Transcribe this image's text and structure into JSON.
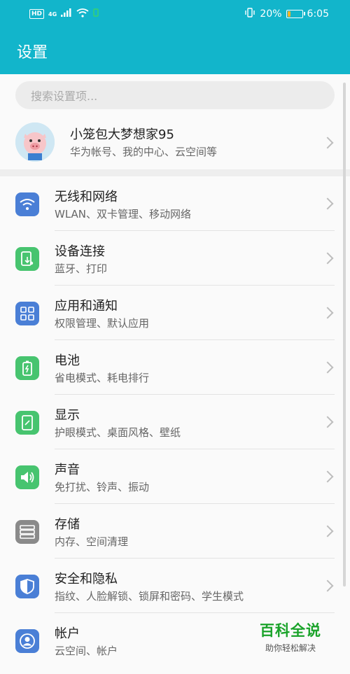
{
  "status_bar": {
    "hd": "HD",
    "network": "4G",
    "battery_percent": "20%",
    "battery_level": 0.2,
    "time": "6:05"
  },
  "header": {
    "title": "设置"
  },
  "search": {
    "placeholder": "搜索设置项..."
  },
  "profile": {
    "name": "小笼包大梦想家95",
    "subtitle": "华为帐号、我的中心、云空间等"
  },
  "settings": [
    {
      "title": "无线和网络",
      "desc": "WLAN、双卡管理、移动网络",
      "icon": "wifi-icon",
      "color": "#4a7fd6"
    },
    {
      "title": "设备连接",
      "desc": "蓝牙、打印",
      "icon": "device-connect-icon",
      "color": "#47c46f"
    },
    {
      "title": "应用和通知",
      "desc": "权限管理、默认应用",
      "icon": "apps-grid-icon",
      "color": "#4a7fd6"
    },
    {
      "title": "电池",
      "desc": "省电模式、耗电排行",
      "icon": "battery-icon",
      "color": "#47c46f"
    },
    {
      "title": "显示",
      "desc": "护眼模式、桌面风格、壁纸",
      "icon": "display-icon",
      "color": "#47c46f"
    },
    {
      "title": "声音",
      "desc": "免打扰、铃声、振动",
      "icon": "speaker-icon",
      "color": "#47c46f"
    },
    {
      "title": "存储",
      "desc": "内存、空间清理",
      "icon": "storage-icon",
      "color": "#8a8a8a"
    },
    {
      "title": "安全和隐私",
      "desc": "指纹、人脸解锁、锁屏和密码、学生模式",
      "icon": "shield-icon",
      "color": "#4a7fd6"
    },
    {
      "title": "帐户",
      "desc": "云空间、帐户",
      "icon": "account-icon",
      "color": "#4a7fd6"
    }
  ],
  "watermark": {
    "title": "百科全说",
    "subtitle": "助你轻松解决"
  }
}
